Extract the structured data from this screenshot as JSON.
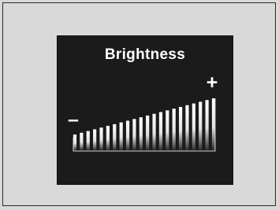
{
  "dialog": {
    "title": "Brightness",
    "increase_label": "+",
    "decrease_label": "–"
  },
  "brightness": {
    "level": 1.0,
    "segments": 22
  },
  "colors": {
    "page_background": "#d9d9d9",
    "panel_background": "#1b1b1b",
    "bar_color": "#ffffff",
    "text_color": "#ffffff"
  }
}
